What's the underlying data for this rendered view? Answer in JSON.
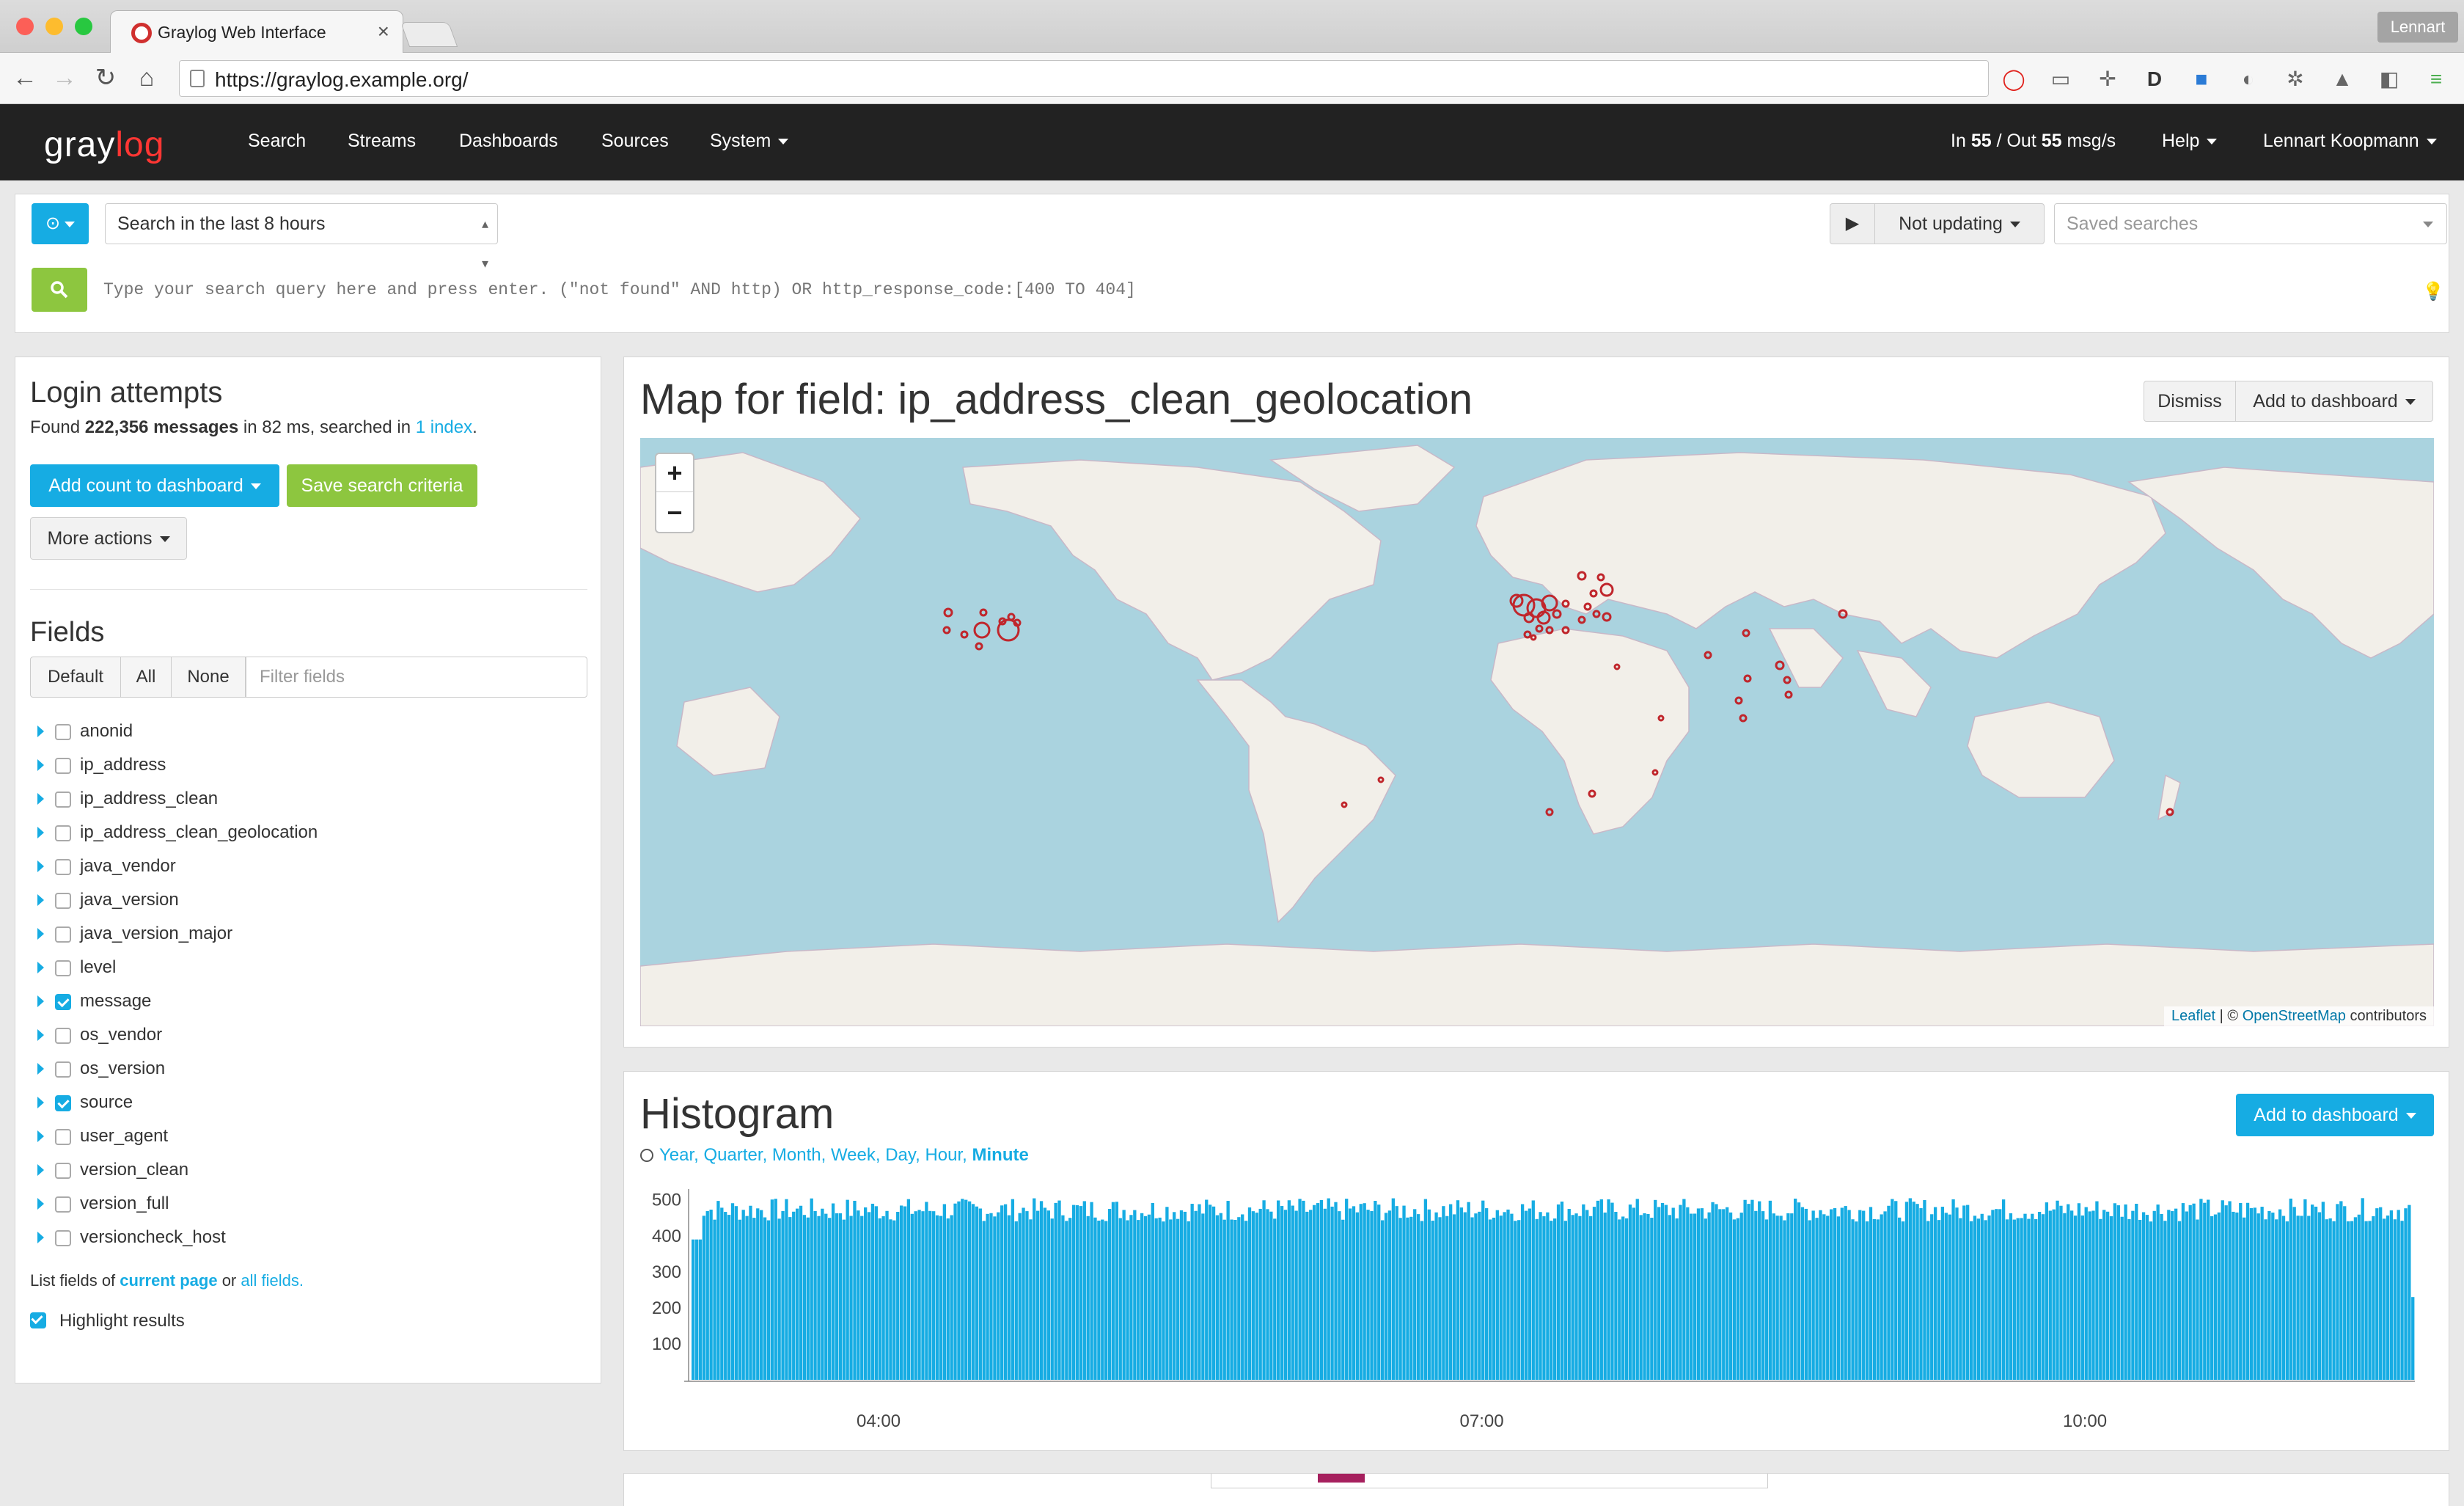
{
  "browser": {
    "tab_title": "Graylog Web Interface",
    "url": "https://graylog.example.org/",
    "profile": "Lennart"
  },
  "nav": {
    "logo_gray": "gray",
    "logo_log": "log",
    "links": [
      "Search",
      "Streams",
      "Dashboards",
      "Sources",
      "System"
    ],
    "throughput_in": "55",
    "throughput_out": "55",
    "throughput_prefix": "In",
    "throughput_mid": "/ Out",
    "throughput_suffix": "msg/s",
    "help": "Help",
    "user": "Lennart Koopmann"
  },
  "search": {
    "time_range": "Search in the last 8 hours",
    "update_label": "Not updating",
    "saved_placeholder": "Saved searches",
    "query_placeholder": "Type your search query here and press enter. (\"not found\" AND http) OR http_response_code:[400 TO 404]"
  },
  "sidebar": {
    "title": "Login attempts",
    "found_prefix": "Found",
    "found_count": "222,356 messages",
    "found_mid": "in 82 ms, searched in",
    "found_index": "1 index",
    "found_end": ".",
    "add_count": "Add count to dashboard",
    "save_criteria": "Save search criteria",
    "more_actions": "More actions",
    "fields_title": "Fields",
    "tabs": [
      "Default",
      "All",
      "None"
    ],
    "filter_placeholder": "Filter fields",
    "fields": [
      {
        "name": "anonid",
        "checked": false
      },
      {
        "name": "ip_address",
        "checked": false
      },
      {
        "name": "ip_address_clean",
        "checked": false
      },
      {
        "name": "ip_address_clean_geolocation",
        "checked": false
      },
      {
        "name": "java_vendor",
        "checked": false
      },
      {
        "name": "java_version",
        "checked": false
      },
      {
        "name": "java_version_major",
        "checked": false
      },
      {
        "name": "level",
        "checked": false
      },
      {
        "name": "message",
        "checked": true
      },
      {
        "name": "os_vendor",
        "checked": false
      },
      {
        "name": "os_version",
        "checked": false
      },
      {
        "name": "source",
        "checked": true
      },
      {
        "name": "user_agent",
        "checked": false
      },
      {
        "name": "version_clean",
        "checked": false
      },
      {
        "name": "version_full",
        "checked": false
      },
      {
        "name": "versioncheck_host",
        "checked": false
      }
    ],
    "list_prefix": "List fields of",
    "list_current": "current page",
    "list_or": "or",
    "list_all": "all fields.",
    "highlight": "Highlight results"
  },
  "map": {
    "title": "Map for field: ip_address_clean_geolocation",
    "dismiss": "Dismiss",
    "add_dashboard": "Add to dashboard",
    "zoom_in": "+",
    "zoom_out": "−",
    "attr_leaflet": "Leaflet",
    "attr_sep": "| ©",
    "attr_osm": "OpenStreetMap",
    "attr_contrib": "contributors",
    "colors": {
      "water": "#aad3df",
      "land": "#f2efe9",
      "marker": "#c0262c"
    }
  },
  "histogram": {
    "title": "Histogram",
    "add_dashboard": "Add to dashboard",
    "resolutions": [
      "Year",
      "Quarter",
      "Month",
      "Week",
      "Day",
      "Hour",
      "Minute"
    ],
    "selected_resolution": "Minute",
    "bar_color": "#16ace3"
  },
  "chart_data": {
    "type": "bar",
    "x_ticks": [
      "04:00",
      "07:00",
      "10:00"
    ],
    "y_ticks": [
      100,
      200,
      300,
      400,
      500
    ],
    "ylim": [
      0,
      530
    ],
    "bar_count": 480,
    "typical_value": 470,
    "value_range": [
      440,
      505
    ]
  }
}
